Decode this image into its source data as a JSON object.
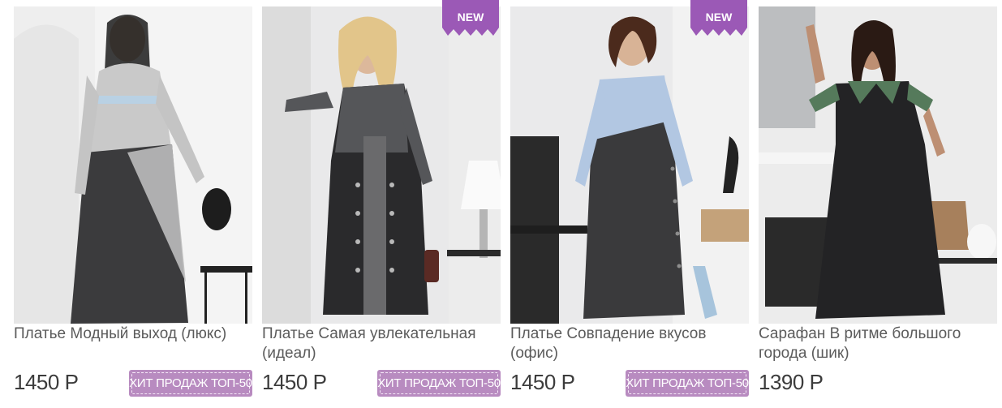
{
  "products": [
    {
      "title": "Платье Модный выход (люкс)",
      "price": "1450 Р",
      "badge": "ХИТ ПРОДАЖ ТОП-50",
      "new": ""
    },
    {
      "title": "Платье Самая увлекательная (идеал)",
      "price": "1450 Р",
      "badge": "ХИТ ПРОДАЖ ТОП-50",
      "new": "NEW"
    },
    {
      "title": "Платье Совпадение вкусов (офис)",
      "price": "1450 Р",
      "badge": "ХИТ ПРОДАЖ ТОП-50",
      "new": "NEW"
    },
    {
      "title": "Сарафан В ритме большого города (шик)",
      "price": "1390 Р",
      "badge": "",
      "new": ""
    }
  ],
  "colors": {
    "new_badge": "#9b59b6",
    "hit_badge": "#b88bc0",
    "title": "#5b5b5b",
    "price": "#3c3c3c"
  },
  "icons": {
    "new_badge": "new-starburst-icon"
  }
}
